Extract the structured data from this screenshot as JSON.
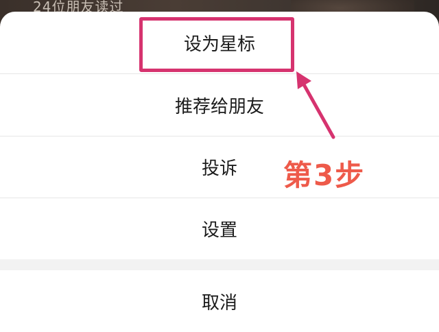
{
  "background": {
    "caption": "24位朋友读过"
  },
  "menu": {
    "items": [
      {
        "label": "设为星标"
      },
      {
        "label": "推荐给朋友"
      },
      {
        "label": "投诉"
      },
      {
        "label": "设置"
      }
    ],
    "cancel_label": "取消"
  },
  "annotation": {
    "step_label": "第3步",
    "highlight_color": "#d6336f",
    "text_color": "#ee5a4a"
  }
}
